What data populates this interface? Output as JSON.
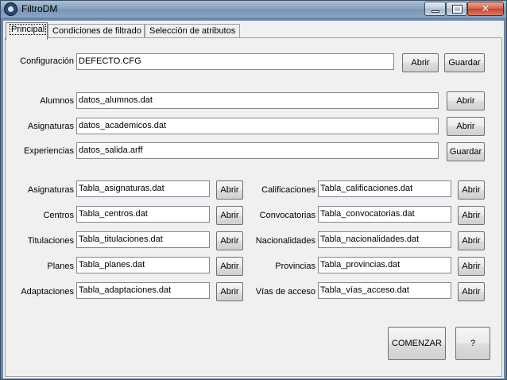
{
  "window": {
    "title": "FiltroDM",
    "controls": {
      "minimize": "",
      "maximize": "",
      "close": "✕"
    }
  },
  "tabs": [
    {
      "label": "Principal"
    },
    {
      "label": "Condiciones de filtrado"
    },
    {
      "label": "Selección de atributos"
    }
  ],
  "config": {
    "label": "Configuración",
    "value": "DEFECTO.CFG",
    "open_label": "Abrir",
    "save_label": "Guardar"
  },
  "data_files": {
    "alumnos": {
      "label": "Alumnos",
      "value": "datos_alumnos.dat",
      "button": "Abrir"
    },
    "asignaturas": {
      "label": "Asignaturas",
      "value": "datos_academicos.dat",
      "button": "Abrir"
    },
    "experiencias": {
      "label": "Experiencias",
      "value": "datos_salida.arff",
      "button": "Guardar"
    }
  },
  "tables_left": [
    {
      "label": "Asignaturas",
      "value": "Tabla_asignaturas.dat",
      "button": "Abrir"
    },
    {
      "label": "Centros",
      "value": "Tabla_centros.dat",
      "button": "Abrir"
    },
    {
      "label": "Titulaciones",
      "value": "Tabla_titulaciones.dat",
      "button": "Abrir"
    },
    {
      "label": "Planes",
      "value": "Tabla_planes.dat",
      "button": "Abrir"
    },
    {
      "label": "Adaptaciones",
      "value": "Tabla_adaptaciones.dat",
      "button": "Abrir"
    }
  ],
  "tables_right": [
    {
      "label": "Calificaciones",
      "value": "Tabla_calificaciones.dat",
      "button": "Abrir"
    },
    {
      "label": "Convocatorias",
      "value": "Tabla_convocatorias.dat",
      "button": "Abrir"
    },
    {
      "label": "Nacionalidades",
      "value": "Tabla_nacionalidades.dat",
      "button": "Abrir"
    },
    {
      "label": "Provincias",
      "value": "Tabla_provincias.dat",
      "button": "Abrir"
    },
    {
      "label": "Vías de acceso",
      "value": "Tabla_vías_acceso.dat",
      "button": "Abrir"
    }
  ],
  "actions": {
    "start_label": "COMENZAR",
    "help_label": "?"
  },
  "colors": {
    "title_bar": "#8aa4c0",
    "close_button": "#c4432c",
    "client_bg": "#f0f0f0"
  }
}
